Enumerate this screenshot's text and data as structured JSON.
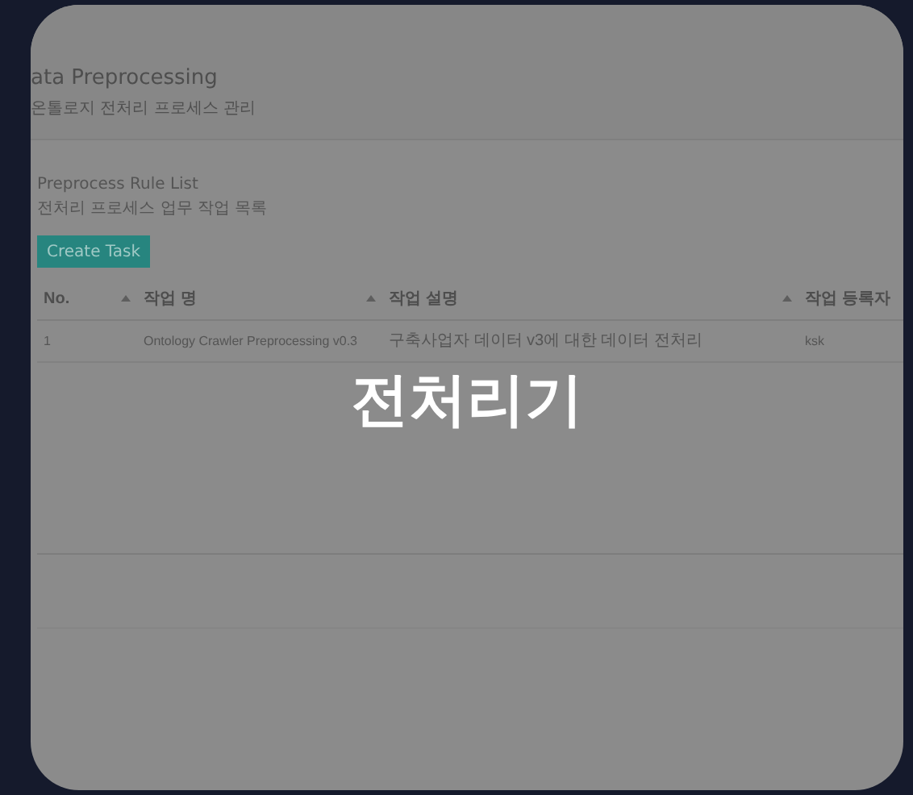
{
  "page": {
    "title": "ata Preprocessing",
    "subtitle": "온톨로지 전처리 프로세스 관리"
  },
  "section": {
    "title": "Preprocess Rule List",
    "subtitle": "전처리 프로세스 업무 작업 목록"
  },
  "create_button": {
    "label": "Create Task"
  },
  "table": {
    "columns": [
      {
        "label": "No.",
        "sortable": true
      },
      {
        "label": "작업 명",
        "sortable": true
      },
      {
        "label": "작업 설명",
        "sortable": true
      },
      {
        "label": "작업 등록자",
        "sortable": false
      }
    ],
    "rows": [
      [
        "1",
        "Ontology Crawler Preprocessing v0.3",
        "구축사업자 데이터 v3에 대한 데이터 전처리",
        "ksk"
      ]
    ]
  },
  "overlay": {
    "label": "전처리기"
  }
}
